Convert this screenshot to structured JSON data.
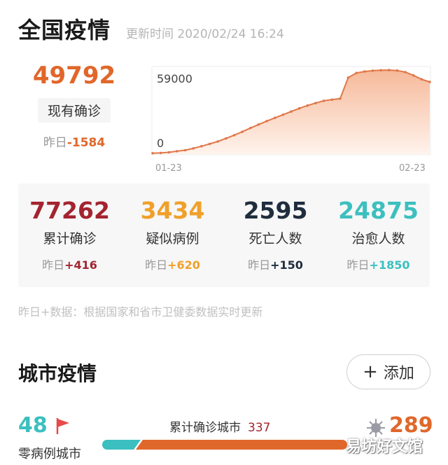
{
  "header": {
    "title": "全国疫情",
    "update_time": "更新时间 2020/02/24 16:24"
  },
  "current": {
    "value": "49792",
    "label": "现有确诊",
    "delta_prefix": "昨日",
    "delta_value": "-1584"
  },
  "chart_data": {
    "type": "area",
    "x_start_label": "01-23",
    "x_end_label": "02-23",
    "y_max_label": "59000",
    "y_min_label": "0",
    "ylim": [
      0,
      59000
    ],
    "values": [
      570,
      770,
      1200,
      1960,
      2640,
      3900,
      5400,
      7000,
      8700,
      10800,
      13000,
      15400,
      18000,
      20400,
      22800,
      25000,
      27200,
      29400,
      31600,
      33500,
      35200,
      36800,
      37600,
      38300,
      52800,
      56000,
      57000,
      57600,
      57900,
      58000,
      57700,
      56600,
      54300,
      51600,
      49792
    ],
    "colors": {
      "line": "#e0784a",
      "fill_top": "#f6b99a",
      "fill_bottom": "#fff3ec"
    }
  },
  "stats": [
    {
      "value": "77262",
      "label": "累计确诊",
      "delta_prefix": "昨日",
      "delta": "+416",
      "color": "#a3242f"
    },
    {
      "value": "3434",
      "label": "疑似病例",
      "delta_prefix": "昨日",
      "delta": "+620",
      "color": "#f0a02a"
    },
    {
      "value": "2595",
      "label": "死亡人数",
      "delta_prefix": "昨日",
      "delta": "+150",
      "color": "#1f2d3d"
    },
    {
      "value": "24875",
      "label": "治愈人数",
      "delta_prefix": "昨日",
      "delta": "+1850",
      "color": "#3cbfbf"
    }
  ],
  "note": "昨日+数据：根据国家和省市卫健委数据实时更新",
  "city": {
    "title": "城市疫情",
    "add_label": "添加",
    "zero_value": "48",
    "zero_label": "零病例城市",
    "cumulative_label": "累计确诊城市",
    "cumulative_value": "337",
    "right_value": "289",
    "progress_fraction": 0.144
  },
  "watermark": "易坊好文馆"
}
